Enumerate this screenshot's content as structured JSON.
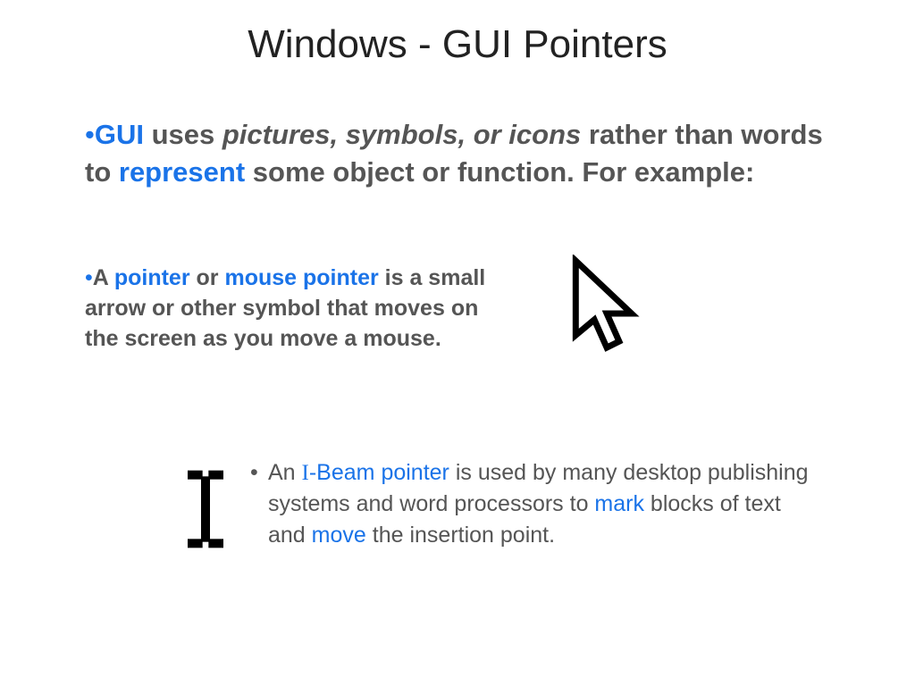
{
  "title": "Windows - GUI Pointers",
  "para1": {
    "bullet": "•",
    "kw_gui": "GUI",
    "seg1": " uses ",
    "italic": "pictures, symbols, or icons",
    "seg2": " rather than words to ",
    "kw_represent": "represent",
    "seg3": " some object or function. For example:"
  },
  "para2": {
    "bullet": "•",
    "seg1": "A ",
    "kw_pointer": "pointer",
    "seg2": " or ",
    "kw_mouse_pointer": "mouse pointer",
    "seg3": " is a small arrow or other symbol that moves on the screen as you move a mouse."
  },
  "para3": {
    "bullet": "•",
    "seg1": "An ",
    "kw_i": "I",
    "kw_beam": "-Beam pointer",
    "seg2": " is used by many desktop publishing systems and word processors to ",
    "kw_mark": "mark",
    "seg3": " blocks of text and ",
    "kw_move": "move",
    "seg4": " the insertion point."
  },
  "icons": {
    "arrow": "mouse-arrow-pointer-icon",
    "ibeam": "i-beam-pointer-icon"
  }
}
